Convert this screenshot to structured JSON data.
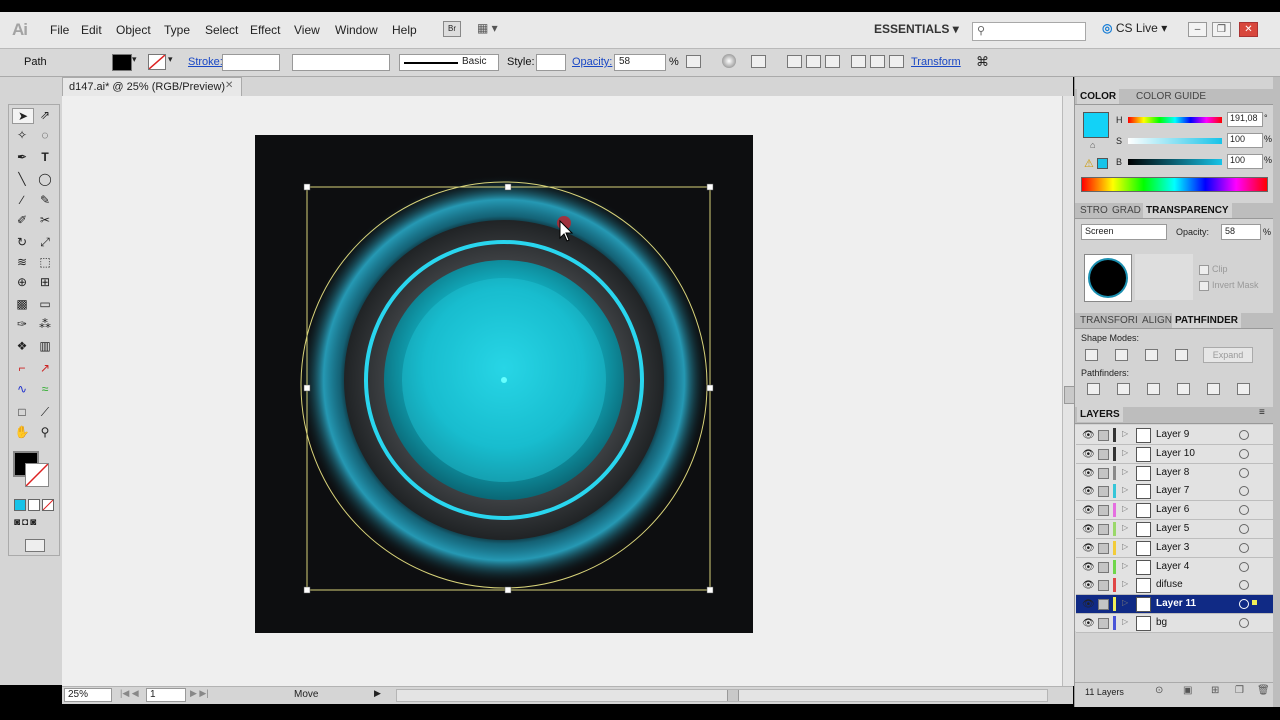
{
  "app": {
    "logo": "Ai",
    "workspace": "ESSENTIALS",
    "cs_live": "CS Live",
    "window_controls": [
      "–",
      "❐",
      "✕"
    ]
  },
  "menu": [
    "File",
    "Edit",
    "Object",
    "Type",
    "Select",
    "Effect",
    "View",
    "Window",
    "Help"
  ],
  "control": {
    "selection_type": "Path",
    "stroke_label": "Stroke:",
    "brush_label": "Basic",
    "style_label": "Style:",
    "opacity_label": "Opacity:",
    "opacity_value": "58",
    "percent": "%",
    "transform_label": "Transform"
  },
  "document": {
    "tab_title": "d147.ai* @ 25% (RGB/Preview)",
    "close": "✕"
  },
  "status": {
    "zoom": "25%",
    "page": "1",
    "tool": "Move"
  },
  "color_panel": {
    "tabs": [
      "COLOR",
      "COLOR GUIDE"
    ],
    "h_label": "H",
    "h_value": "191,08",
    "h_unit": "°",
    "s_label": "S",
    "s_value": "100",
    "s_unit": "%",
    "b_label": "B",
    "b_value": "100",
    "b_unit": "%",
    "fill_color": "#12d2f7"
  },
  "transparency_panel": {
    "tabs": [
      "STRO",
      "GRAD",
      "TRANSPARENCY"
    ],
    "blend_mode": "Screen",
    "opacity_label": "Opacity:",
    "opacity_value": "58",
    "percent": "%",
    "clip": "Clip",
    "invert_mask": "Invert Mask"
  },
  "pathfinder_panel": {
    "tabs": [
      "TRANSFORI",
      "ALIGN",
      "PATHFINDER"
    ],
    "shape_modes": "Shape Modes:",
    "expand": "Expand",
    "pathfinders": "Pathfinders:"
  },
  "layers_panel": {
    "title": "LAYERS",
    "footer": "11 Layers",
    "layers": [
      {
        "name": "Layer 9",
        "color": "#333333",
        "selected": false
      },
      {
        "name": "Layer 10",
        "color": "#333333",
        "selected": false
      },
      {
        "name": "Layer 8",
        "color": "#8a8a8a",
        "selected": false
      },
      {
        "name": "Layer 7",
        "color": "#36c6d8",
        "selected": false
      },
      {
        "name": "Layer 6",
        "color": "#e56ee0",
        "selected": false
      },
      {
        "name": "Layer 5",
        "color": "#9ad86a",
        "selected": false
      },
      {
        "name": "Layer 3",
        "color": "#f2cc3a",
        "selected": false
      },
      {
        "name": "Layer 4",
        "color": "#6fd64a",
        "selected": false
      },
      {
        "name": "difuse",
        "color": "#e04646",
        "selected": false
      },
      {
        "name": "Layer 11",
        "color": "#f0ee58",
        "selected": true
      },
      {
        "name": "bg",
        "color": "#4a55d8",
        "selected": false
      }
    ]
  }
}
